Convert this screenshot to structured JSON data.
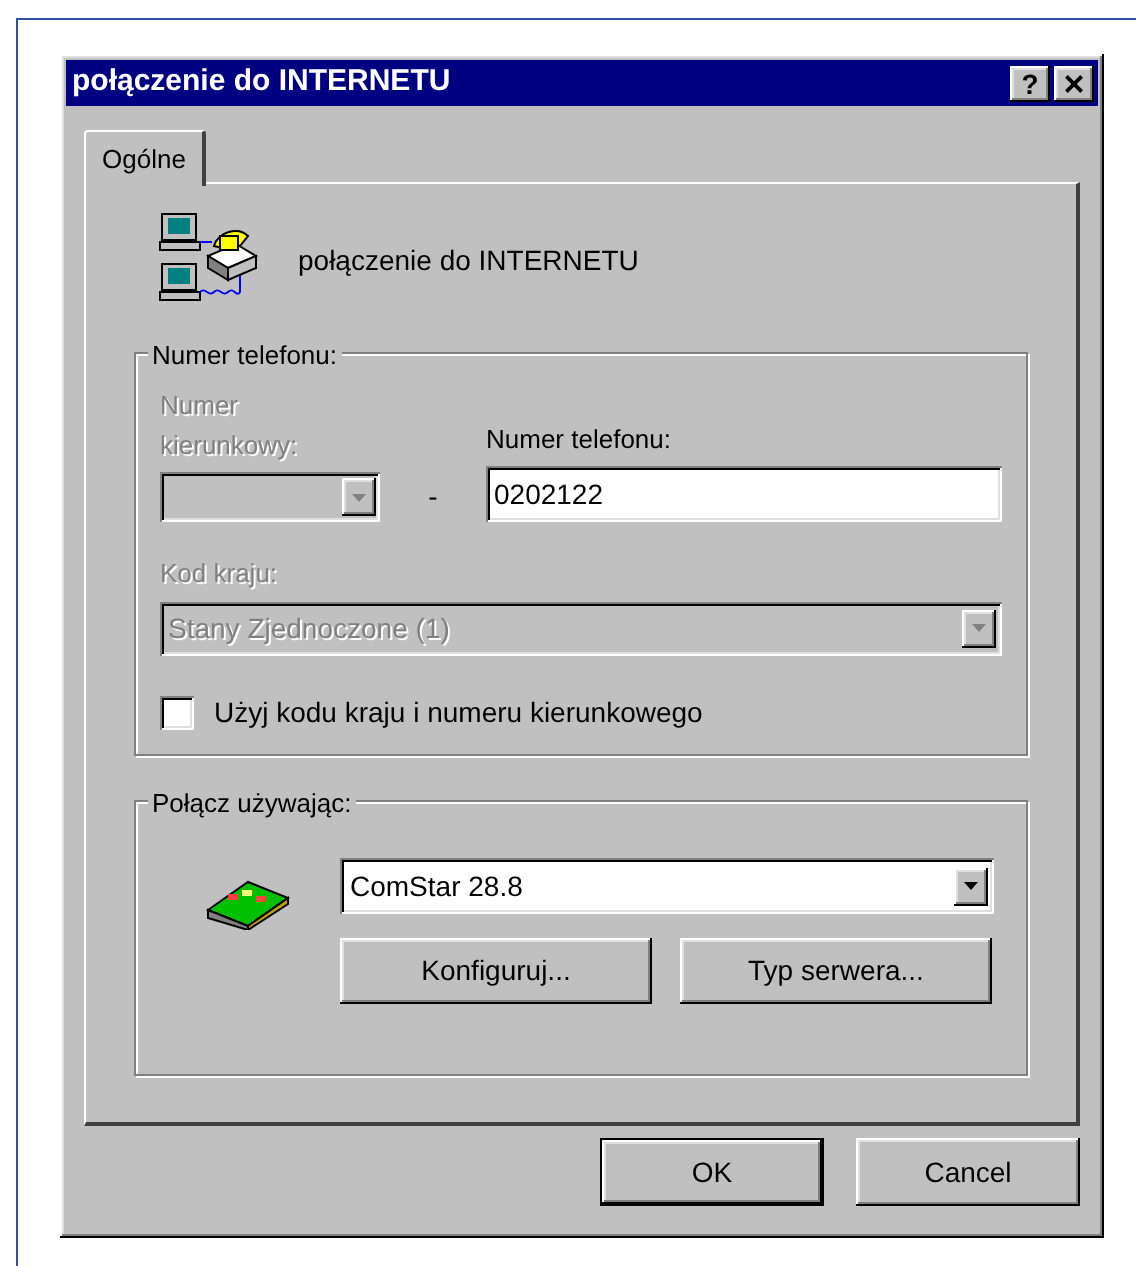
{
  "window": {
    "title": "połączenie do INTERNETU",
    "title_buttons": [
      {
        "kind": "help",
        "label": "?"
      },
      {
        "kind": "close",
        "label": "×"
      }
    ]
  },
  "tabs": [
    {
      "label": "Ogólne",
      "selected": true
    }
  ],
  "connection_name": "połączenie do INTERNETU",
  "phone_group": {
    "title": "Numer telefonu:",
    "area_code": {
      "label": "Numer kierunkowy:",
      "disabled": true
    },
    "separator": "-",
    "phone_number": {
      "label": "Numer telefonu:",
      "value": "0202122",
      "disabled": false
    },
    "country_code": {
      "label": "Kod kraju:",
      "value": "Stany Zjednoczone (1)",
      "disabled": true
    },
    "use_codes": {
      "label": "Użyj kodu kraju i numeru kierunkowego",
      "checked": false
    }
  },
  "connect_group": {
    "title": "Połącz używając:",
    "device": "ComStar 28.8",
    "buttons": [
      "Konfiguruj...",
      "Typ serwera..."
    ]
  },
  "buttons": [
    {
      "label": "OK",
      "default": true
    },
    {
      "label": "Cancel",
      "default": false
    }
  ]
}
